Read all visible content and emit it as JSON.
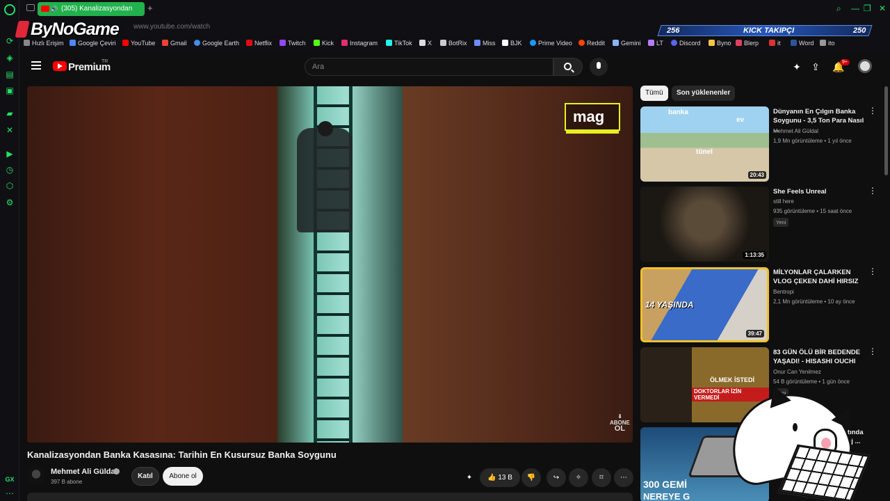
{
  "browser": {
    "tab_title": "(305) Kanalizasyondan",
    "url": "www.youtube.com/watch",
    "overlay_brand": "ByNoGame",
    "kick_banner": {
      "left": "256",
      "label": "KICK TAKIPÇI",
      "right": "250"
    },
    "gx_label": "GX",
    "bookmarks": [
      "Hızlı Erişim",
      "Google Çeviri",
      "YouTube",
      "Gmail",
      "Google Earth",
      "Netflix",
      "Twitch",
      "Kick",
      "Instagram",
      "TikTok",
      "X",
      "BotRix",
      "Miss",
      "BJK",
      "Prime Video",
      "Reddit",
      "Gemini",
      "LT",
      "Discord",
      "Byno",
      "Blerp",
      "it",
      "Word",
      "ito"
    ]
  },
  "youtube": {
    "brand": "Premium",
    "region": "TR",
    "search_placeholder": "Ara",
    "notif_count": "9+"
  },
  "player": {
    "watermark": "mag",
    "abone_line1": "ABONE",
    "abone_line2": "OL"
  },
  "video": {
    "title": "Kanalizasyondan Banka Kasasına: Tarihin En Kusursuz Banka Soygunu",
    "channel": "Mehmet Ali Güldal",
    "subscribers": "397 B abone",
    "join_label": "Katıl",
    "subscribe_label": "Abone ol",
    "likes": "13 B"
  },
  "chips": {
    "all": "Tümü",
    "recent": "Son yüklenenler"
  },
  "recommendations": [
    {
      "title": "Dünyanın En Çılgın Banka Soygunu - 3,5 Ton Para Nasıl ...",
      "channel": "Mehmet Ali Güldal",
      "meta": "1,9 Mn görüntüleme • 1 yıl önce",
      "duration": "20:43",
      "badge": "",
      "thumb_text": [
        "banka",
        "ev",
        "tünel"
      ]
    },
    {
      "title": "She Feels Unreal",
      "channel": "still here",
      "meta": "935 görüntüleme • 15 saat önce",
      "duration": "1:13:35",
      "badge": "Yeni",
      "thumb_text": []
    },
    {
      "title": "MİLYONLAR ÇALARKEN VLOG ÇEKEN DAHİ HIRSIZ",
      "channel": "Bentropi",
      "meta": "2,1 Mn görüntüleme • 10 ay önce",
      "duration": "39:47",
      "badge": "",
      "thumb_text": [
        "14 YAŞINDA"
      ]
    },
    {
      "title": "83 GÜN ÖLÜ BİR BEDENDE YAŞADI! - HISASHI OUCHI",
      "channel": "Onur Can Yenilmez",
      "meta": "54 B görüntüleme • 1 gün önce",
      "duration": "",
      "badge": "Yeni",
      "thumb_text": [
        "ÖLMEK İSTEDİ",
        "DOKTORLAR İZİN VERMEDİ"
      ]
    },
    {
      "title": "...tında ...aj ...",
      "channel": "",
      "meta": "",
      "duration": "",
      "badge": "",
      "thumb_text": [
        "300 GEMİ",
        "NEREYE G"
      ]
    }
  ],
  "colors": {
    "gx_accent": "#22e06a",
    "yt_red": "#ff0000",
    "highlight": "#f2c02a"
  }
}
